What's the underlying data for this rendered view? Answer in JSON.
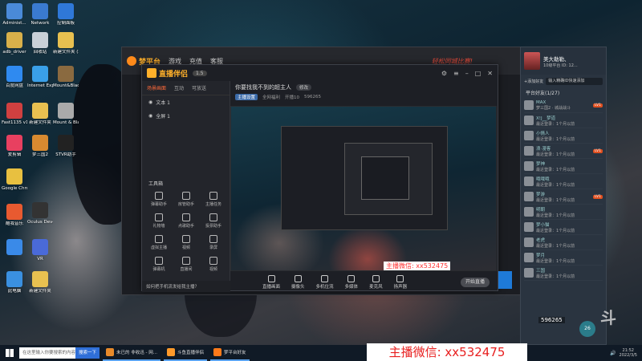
{
  "desktop": {
    "icons": [
      {
        "label": "Administ...",
        "color": "#4a8ad8"
      },
      {
        "label": "Network",
        "color": "#3a7ad0"
      },
      {
        "label": "控制面板",
        "color": "#2f78d8"
      },
      {
        "label": "adb_driver",
        "color": "#d8b04a"
      },
      {
        "label": "回收站",
        "color": "#c8d0d8"
      },
      {
        "label": "新建文件夹 (2)",
        "color": "#e8c050"
      },
      {
        "label": "百度网盘",
        "color": "#2f8af0"
      },
      {
        "label": "Internet Explorer",
        "color": "#3aa0e8"
      },
      {
        "label": "Mount&Blade Warband",
        "color": "#8a6a40"
      },
      {
        "label": "Fast1135 v1.1",
        "color": "#d04040"
      },
      {
        "label": "新建文件夹",
        "color": "#e8c050"
      },
      {
        "label": "Mount & Blade II ...",
        "color": "#aaaaaa"
      },
      {
        "label": "爱剪辑",
        "color": "#e84060"
      },
      {
        "label": "梦三国2",
        "color": "#d88a30"
      },
      {
        "label": "STVR助手",
        "color": "#222222"
      },
      {
        "label": "Google Chrome",
        "color": "#e8c040"
      },
      {
        "label": "Oculus Develop...",
        "color": "#333333"
      },
      {
        "label": "酷我音乐",
        "color": "#e85a30"
      },
      {
        "label": "VR",
        "color": "#4a6ad8"
      },
      {
        "label": "",
        "color": "#3a8ae8"
      },
      {
        "label": "此电脑",
        "color": "#3a90e0"
      },
      {
        "label": "新建文件夹",
        "color": "#e8c050"
      }
    ]
  },
  "mengpingtai": {
    "logo": "梦平台",
    "nav": [
      "游戏",
      "充值",
      "客服"
    ],
    "slogan": "轻松同城比赛!"
  },
  "zhibo": {
    "logo": "直播伴侣",
    "version": "1.5",
    "tabs": [
      "场景画面",
      "互动",
      "可放送"
    ],
    "scenes": [
      "文本 1",
      "全屏 1"
    ],
    "tools_heading": "工具箱",
    "tools": [
      "弹幕助手",
      "房管助手",
      "主播任务",
      "礼物墙",
      "点歌助手",
      "投票助手",
      "虚拟主播",
      "视频",
      "录屏",
      "弹幕机",
      "直播间",
      "视频"
    ],
    "hint": "如何把手机流发给我主播？",
    "room_title": "你要找我不到的超主人",
    "room_tag": "修改",
    "room_sub": [
      "主播设置",
      "全网福利",
      "开播10",
      "596265"
    ],
    "overlay": "主播微信:  xx532475",
    "bottom_tools": [
      "直播画面",
      "摄像头",
      "多机位流",
      "多媒体",
      "麦克风",
      "扬声器"
    ],
    "start_button": "开始直播"
  },
  "friends": {
    "name": "美大勒勒、",
    "status": "10级平台 ID: 12...",
    "add_button": "+添加好友",
    "search_placeholder": "输入精确ID快速添加",
    "group": "平台好友(1/27)",
    "list": [
      {
        "name": "MAX",
        "status": "梦三国2 · 城战战斗",
        "level": "LV1"
      },
      {
        "name": "X!J__梦道",
        "status": "最近登录：1个月以前",
        "level": ""
      },
      {
        "name": "小情人",
        "status": "最近登录：1个月以前",
        "level": ""
      },
      {
        "name": "浪·漫客",
        "status": "最近登录：1个月以前",
        "level": "LV1"
      },
      {
        "name": "梦神",
        "status": "最近登录：1个月以前",
        "level": ""
      },
      {
        "name": "哦哦哦",
        "status": "最近登录：1个月以前",
        "level": ""
      },
      {
        "name": "梦游",
        "status": "最近登录：1个月以前",
        "level": "LV1"
      },
      {
        "name": "明朝",
        "status": "最近登录：1个月以前",
        "level": ""
      },
      {
        "name": "梦小猫",
        "status": "最近登录：1个月以前",
        "level": ""
      },
      {
        "name": "老虎",
        "status": "最近登录：1个月以前",
        "level": ""
      },
      {
        "name": "梦月",
        "status": "最近登录：1个月以前",
        "level": ""
      },
      {
        "name": "三国",
        "status": "最近登录：1个月以前",
        "level": ""
      }
    ],
    "count": "596265"
  },
  "taskbar": {
    "search": "在这里输入你要搜索的内容",
    "search_button": "搜索一下",
    "apps": [
      {
        "label": "未已的 非收迅 - 网...",
        "color": "#e88a2a"
      },
      {
        "label": "斗鱼直播伴侣",
        "color": "#ff9a2a"
      },
      {
        "label": "梦平台好友",
        "color": "#ff7a1a"
      }
    ],
    "tray": "26",
    "clock_time": "21:52",
    "clock_date": "2022/3/5"
  },
  "banner": "主播微信:  xx532475"
}
